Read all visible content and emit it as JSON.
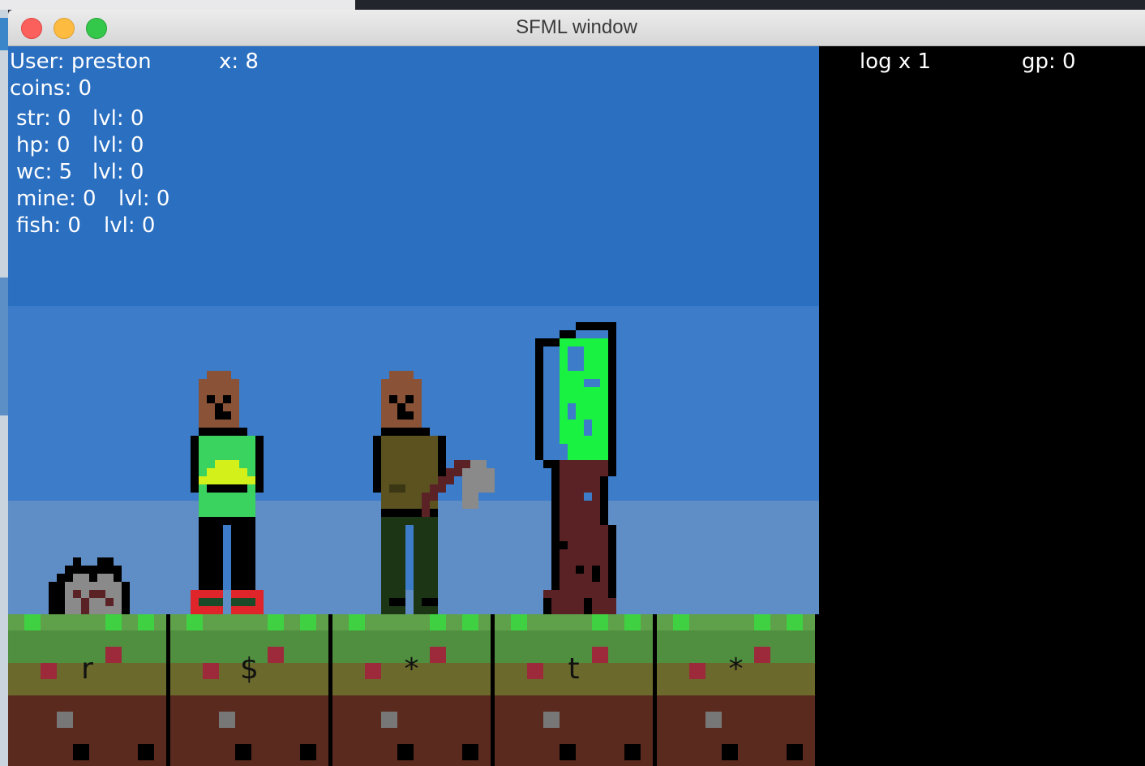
{
  "window": {
    "title": "SFML window"
  },
  "hud": {
    "user": "User: preston",
    "x": "x: 8",
    "coins": "coins: 0",
    "skills": [
      {
        "name": "str: 0",
        "level": "lvl: 0"
      },
      {
        "name": "hp: 0",
        "level": "lvl: 0"
      },
      {
        "name": "wc: 5",
        "level": "lvl: 0"
      },
      {
        "name": "mine: 0",
        "level": "lvl: 0"
      },
      {
        "name": "fish: 0",
        "level": "lvl: 0"
      }
    ]
  },
  "inventory": {
    "item": "log x 1",
    "gp": "gp: 0"
  },
  "tiles": [
    {
      "label": "r"
    },
    {
      "label": "$"
    },
    {
      "label": "*"
    },
    {
      "label": "t"
    },
    {
      "label": "*"
    }
  ],
  "sprites": {
    "rock": "rock-sprite",
    "player": "player-sprite",
    "woodcutter": "woodcutter-npc-sprite",
    "tree": "tree-sprite"
  },
  "colors": {
    "sky": "#2b6fc0",
    "player_shirt": "#3ad35f",
    "tree_leaves": "#19f241",
    "tree_trunk": "#5b2226",
    "grass": "#5fa04a"
  }
}
